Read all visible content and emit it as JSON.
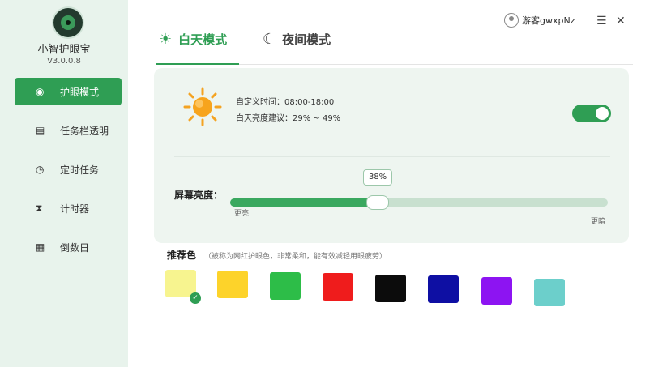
{
  "app": {
    "name": "小智护眼宝",
    "version": "V3.0.0.8"
  },
  "sidebar": {
    "items": [
      {
        "label": "护眼模式",
        "icon": "eye-icon",
        "active": true
      },
      {
        "label": "任务栏透明",
        "icon": "taskbar-icon",
        "active": false
      },
      {
        "label": "定时任务",
        "icon": "clock-icon",
        "active": false
      },
      {
        "label": "计时器",
        "icon": "hourglass-icon",
        "active": false
      },
      {
        "label": "倒数日",
        "icon": "calendar-icon",
        "active": false
      }
    ]
  },
  "tabs": [
    {
      "label": "白天模式",
      "icon": "sun-icon",
      "active": true
    },
    {
      "label": "夜间模式",
      "icon": "moon-icon",
      "active": false
    }
  ],
  "user": {
    "name": "游客gwxpNz",
    "icon": "avatar-icon"
  },
  "window": {
    "menu_icon": "menu-icon",
    "close_icon": "close-icon"
  },
  "day_mode": {
    "custom_time": "自定义时间：08:00-18:00",
    "brightness_hint": "白天亮度建议：29% ~ 49%",
    "enabled": true
  },
  "brightness": {
    "label": "屏幕亮度：",
    "value_text": "38%",
    "value": 38,
    "low_label": "更亮",
    "high_label": "更暗"
  },
  "recommend": {
    "title": "推荐色",
    "note": "（被称为网红护眼色，非常柔和，能有效减轻用眼疲劳）",
    "colors": [
      "#f7f48f",
      "#fdd32a",
      "#2dbd48",
      "#ef1c1c",
      "#0c0c0c",
      "#0e0fa3",
      "#8d14f2",
      "#6ccfcb"
    ],
    "selected_index": 0
  },
  "colors": {
    "accent": "#2f9e54",
    "sidebar_bg": "#e8f3ec",
    "card_bg": "#eef5f0"
  }
}
